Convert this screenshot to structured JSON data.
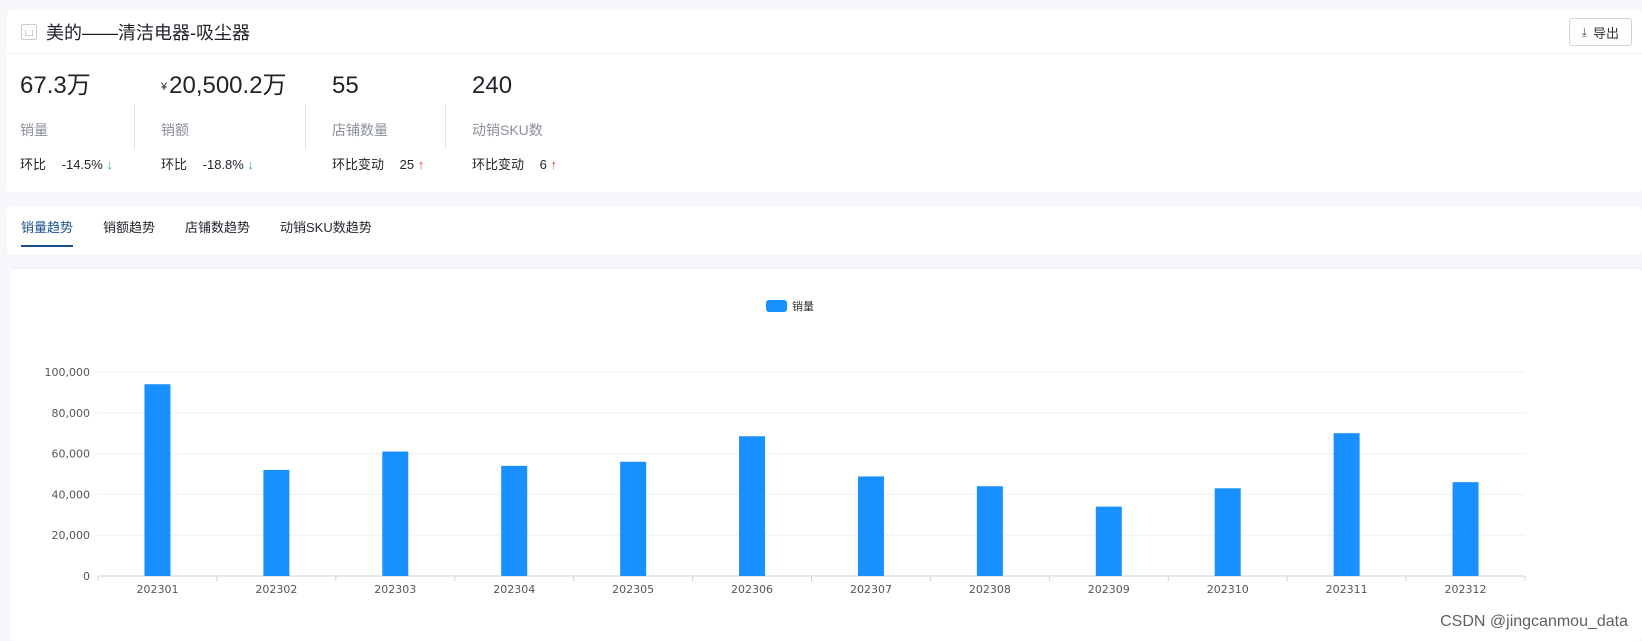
{
  "header": {
    "title": "美的——清洁电器-吸尘器",
    "export_label": "导出"
  },
  "metrics": [
    {
      "value": "67.3万",
      "label": "销量",
      "change_label": "环比",
      "change_value": "-14.5%",
      "arrow": "↓",
      "dir": "down"
    },
    {
      "currency": "¥",
      "value": "20,500.2万",
      "label": "销额",
      "change_label": "环比",
      "change_value": "-18.8%",
      "arrow": "↓",
      "dir": "down"
    },
    {
      "value": "55",
      "label": "店铺数量",
      "change_label": "环比变动",
      "change_value": "25",
      "arrow": "↑",
      "dir": "up"
    },
    {
      "value": "240",
      "label": "动销SKU数",
      "change_label": "环比变动",
      "change_value": "6",
      "arrow": "↑",
      "dir": "up"
    }
  ],
  "tabs": [
    {
      "label": "销量趋势",
      "active": true
    },
    {
      "label": "销额趋势",
      "active": false
    },
    {
      "label": "店铺数趋势",
      "active": false
    },
    {
      "label": "动销SKU数趋势",
      "active": false
    }
  ],
  "chart_data": {
    "type": "bar",
    "categories": [
      "202301",
      "202302",
      "202303",
      "202304",
      "202305",
      "202306",
      "202307",
      "202308",
      "202309",
      "202310",
      "202311",
      "202312"
    ],
    "series": [
      {
        "name": "销量",
        "color": "#1890ff",
        "values": [
          94000,
          52000,
          61000,
          54000,
          56000,
          68500,
          48800,
          44000,
          34000,
          43000,
          70000,
          46000
        ]
      }
    ],
    "ylim": [
      0,
      100000
    ],
    "yticks": [
      "0",
      "20,000",
      "40,000",
      "60,000",
      "80,000",
      "100,000"
    ],
    "legend_position": "top-center",
    "grid": true
  },
  "watermark": "CSDN @jingcanmou_data"
}
